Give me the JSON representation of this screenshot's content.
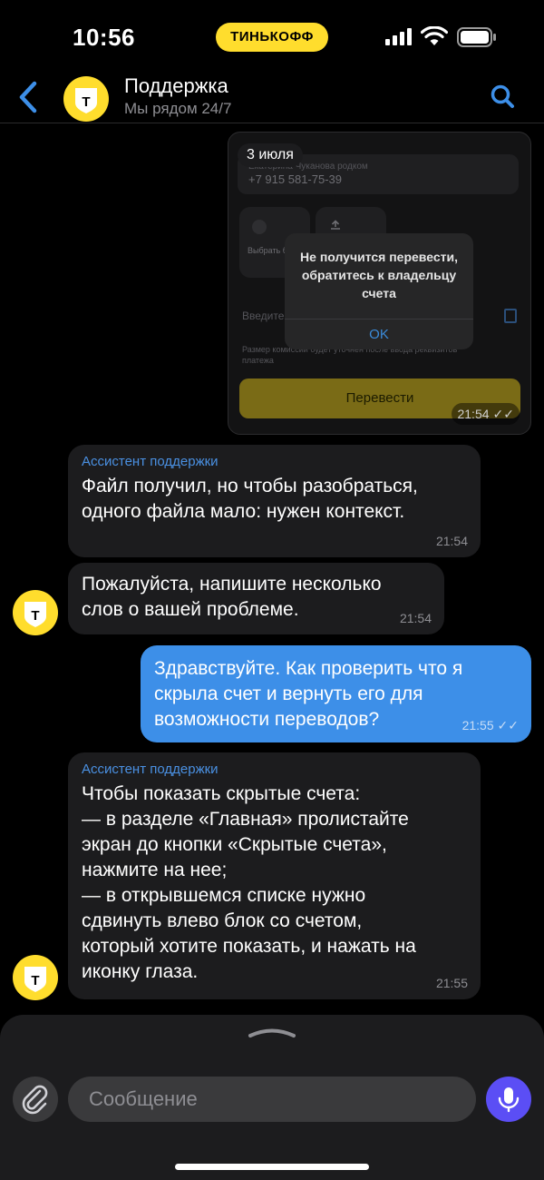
{
  "status_bar": {
    "time": "10:56",
    "carrier": "ТИНЬКОФФ"
  },
  "header": {
    "title": "Поддержка",
    "subtitle": "Мы рядом 24/7",
    "avatar_letter": "Т"
  },
  "image_message": {
    "date": "3 июля",
    "faded_text": "Екатерина Чуканова родком",
    "phone": "+7 915 581-75-39",
    "tile_choose_bank": "Выбрать банк",
    "input_hint": "Введите",
    "fee_note": "Размер комиссии будет уточнен после ввода реквизитов платежа",
    "transfer_button": "Перевести",
    "alert_text": "Не получится перевести, обратитесь к владельцу счета",
    "alert_ok": "OK",
    "time": "21:54",
    "ticks": "✓✓"
  },
  "messages": [
    {
      "sender": "Ассистент поддержки",
      "text": "Файл получил, но чтобы разобраться,\nодного файла мало: нужен контекст.",
      "time": "21:54"
    },
    {
      "text": "Пожалуйста, напишите несколько\nслов о вашей проблеме.",
      "time": "21:54",
      "avatar_letter": "Т"
    },
    {
      "text": "Здравствуйте. Как проверить что я\nскрыла счет и вернуть его для\nвозможности переводов?",
      "time": "21:55",
      "ticks": "✓✓"
    },
    {
      "sender": "Ассистент поддержки",
      "text": "Чтобы показать скрытые счета:\n— в разделе «Главная» пролистайте\nэкран до кнопки «Скрытые счета»,\nнажмите на нее;\n— в открывшемся списке нужно\nсдвинуть влево блок со счетом,\nкоторый хотите показать, и нажать на\nиконку глаза.",
      "time": "21:55",
      "avatar_letter": "Т"
    }
  ],
  "composer": {
    "placeholder": "Сообщение"
  },
  "colors": {
    "accent": "#3d8fe8",
    "brand_yellow": "#ffdd2d",
    "mic": "#5b4ef5",
    "bubble_in": "#1c1c1e"
  }
}
